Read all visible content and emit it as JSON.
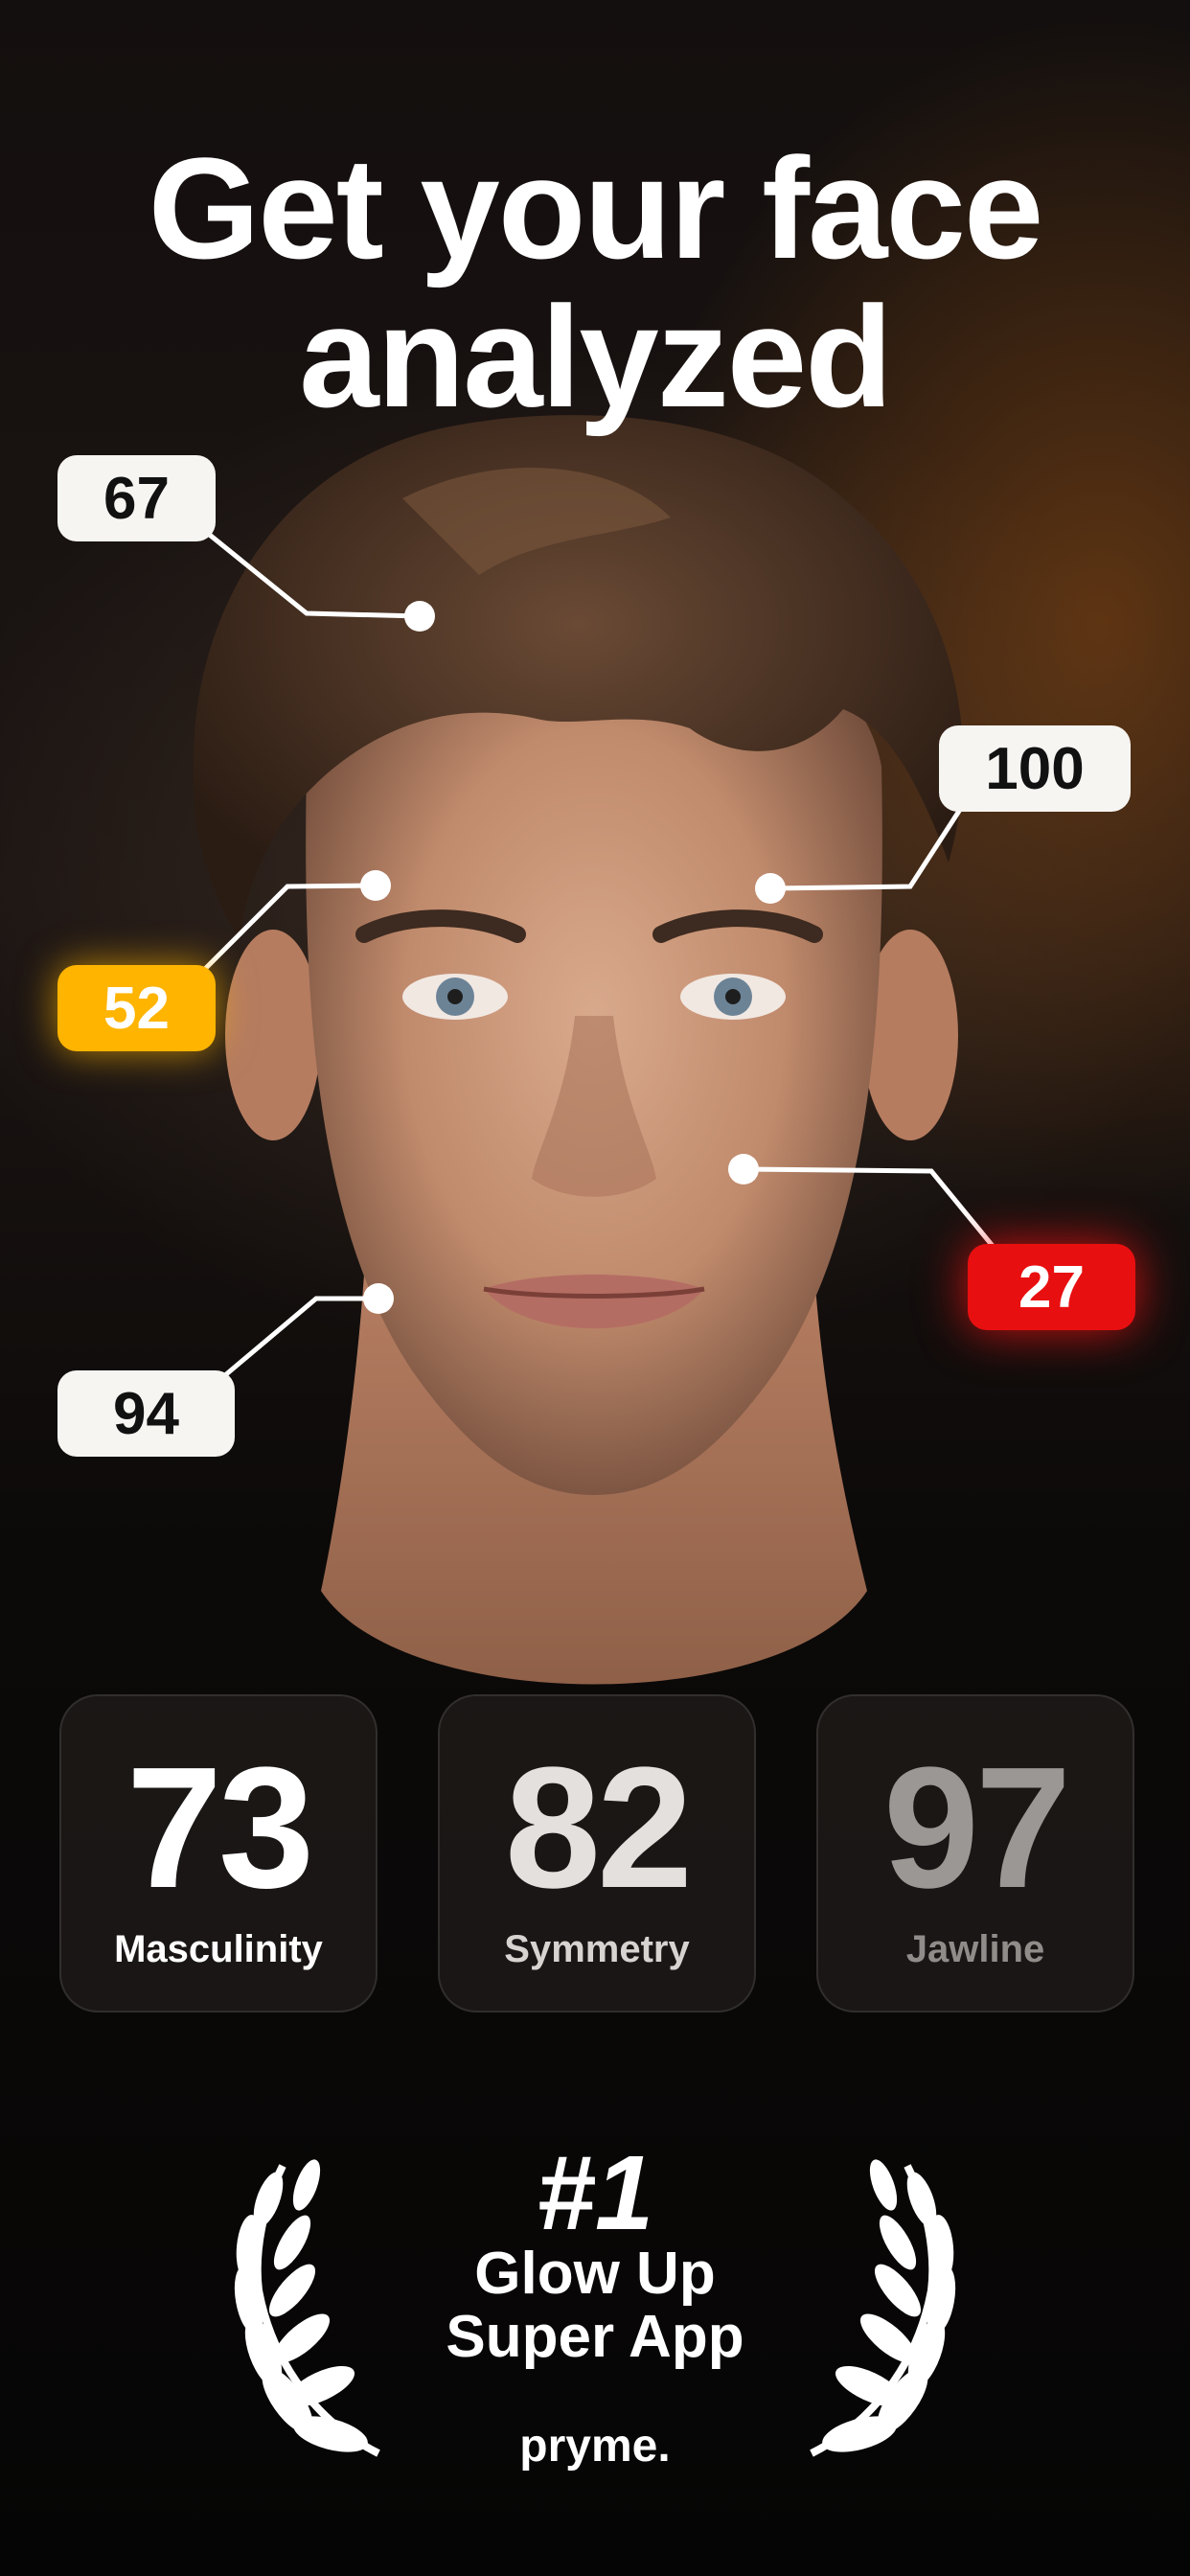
{
  "headline": {
    "line1": "Get your face",
    "line2": "analyzed"
  },
  "callouts": [
    {
      "value": "67",
      "style": "white"
    },
    {
      "value": "100",
      "style": "white"
    },
    {
      "value": "52",
      "style": "yellow"
    },
    {
      "value": "27",
      "style": "red"
    },
    {
      "value": "94",
      "style": "white"
    }
  ],
  "scores": [
    {
      "value": "73",
      "label": "Masculinity"
    },
    {
      "value": "82",
      "label": "Symmetry"
    },
    {
      "value": "97",
      "label": "Jawline"
    }
  ],
  "badge": {
    "rank": "#1",
    "line1": "Glow Up",
    "line2": "Super App",
    "brand": "pryme."
  },
  "colors": {
    "yellow": "#ffb400",
    "red": "#e80f10",
    "card_white": "#f7f5f2"
  },
  "icons": [
    "laurel-left-icon",
    "laurel-right-icon"
  ]
}
